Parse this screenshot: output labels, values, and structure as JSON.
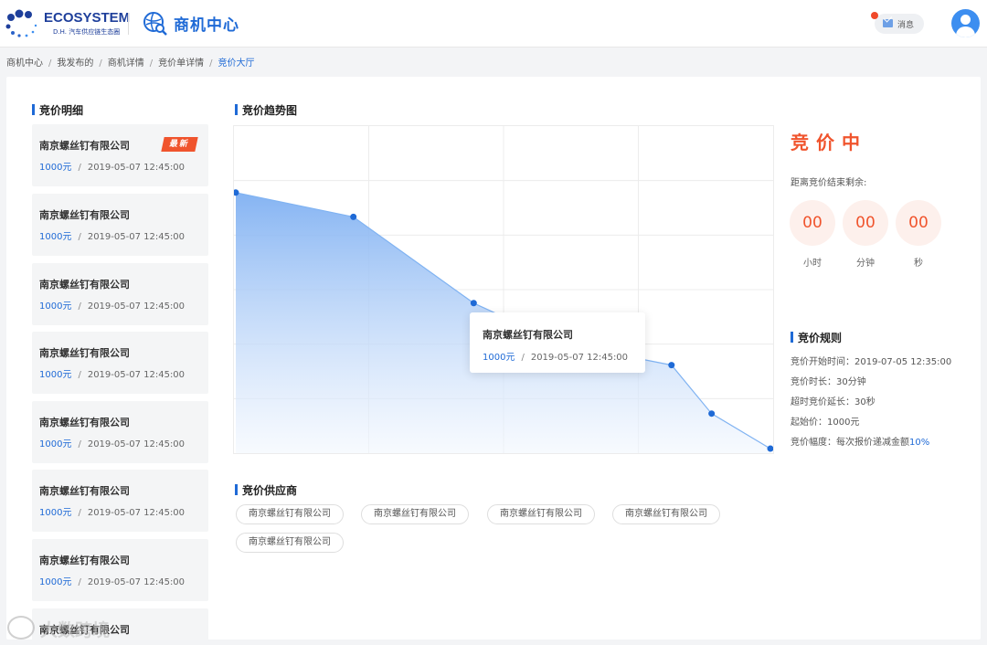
{
  "header": {
    "logo_title": "ECOSYSTEM",
    "logo_subtitle": "D.H. 汽车供应链生态圈",
    "biz_center": "商机中心",
    "message_label": "消息"
  },
  "breadcrumb": {
    "items": [
      "商机中心",
      "我发布的",
      "商机详情",
      "竞价单详情"
    ],
    "current": "竞价大厅",
    "separator": "/"
  },
  "bid_detail": {
    "title": "竞价明细",
    "badge": "最新",
    "items": [
      {
        "company": "南京螺丝钉有限公司",
        "price": "1000元",
        "time": "2019-05-07  12:45:00"
      },
      {
        "company": "南京螺丝钉有限公司",
        "price": "1000元",
        "time": "2019-05-07  12:45:00"
      },
      {
        "company": "南京螺丝钉有限公司",
        "price": "1000元",
        "time": "2019-05-07  12:45:00"
      },
      {
        "company": "南京螺丝钉有限公司",
        "price": "1000元",
        "time": "2019-05-07  12:45:00"
      },
      {
        "company": "南京螺丝钉有限公司",
        "price": "1000元",
        "time": "2019-05-07  12:45:00"
      },
      {
        "company": "南京螺丝钉有限公司",
        "price": "1000元",
        "time": "2019-05-07  12:45:00"
      },
      {
        "company": "南京螺丝钉有限公司",
        "price": "1000元",
        "time": "2019-05-07  12:45:00"
      },
      {
        "company": "南京螺丝钉有限公司",
        "price": "",
        "time": ""
      }
    ]
  },
  "trend": {
    "title": "竞价趋势图",
    "tooltip": {
      "company": "南京螺丝钉有限公司",
      "price": "1000元",
      "time": "2019-05-07  12:45:00"
    }
  },
  "chart_data": {
    "type": "area",
    "title": "",
    "xlabel": "",
    "ylabel": "",
    "grid": true,
    "x": [
      0,
      0.22,
      0.445,
      0.61,
      0.815,
      0.89,
      1.0
    ],
    "xlim": [
      0,
      1
    ],
    "ylim": [
      0,
      6
    ],
    "values": [
      4.8,
      4.35,
      2.75,
      2.0,
      1.6,
      0.7,
      0.05
    ],
    "colors": {
      "line": "#80b3f2",
      "point": "#1f6ad6",
      "fill_top": "#7fb0f2",
      "fill_bottom": "#f2f7fe"
    }
  },
  "status": {
    "label": "竞价中",
    "remain_label": "距离竞价结束剩余:",
    "hours": "00",
    "minutes": "00",
    "seconds": "00",
    "hours_label": "小时",
    "minutes_label": "分钟",
    "seconds_label": "秒"
  },
  "rules": {
    "title": "竞价规则",
    "start_time": "竞价开始时间：2019-07-05  12:35:00",
    "duration": "竞价时长：30分钟",
    "extend": "超时竞价延长：30秒",
    "start_price": "起始价：1000元",
    "step_prefix": "竞价幅度：每次报价递减金额",
    "step_value": "10%"
  },
  "suppliers": {
    "title": "竞价供应商",
    "items": [
      "南京螺丝钉有限公司",
      "南京螺丝钉有限公司",
      "南京螺丝钉有限公司",
      "南京螺丝钉有限公司",
      "南京螺丝钉有限公司"
    ]
  },
  "watermark": "大数跨境"
}
